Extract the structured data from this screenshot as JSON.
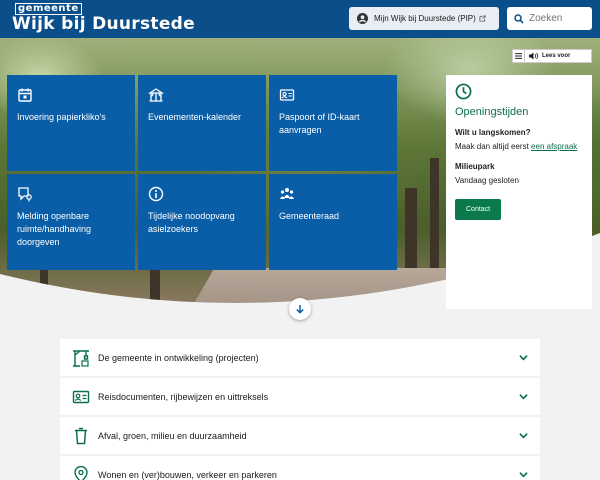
{
  "header": {
    "logo_small": "gemeente",
    "logo_main": "Wijk bij Duurstede",
    "pip_label": "Mijn Wijk bij Duurstede (PIP)",
    "search_placeholder": "Zoeken"
  },
  "readspeaker": {
    "label": "Lees voor"
  },
  "tiles": [
    {
      "label": "Invoering papierkliko's",
      "icon": "calendar-icon"
    },
    {
      "label": "Evenementen-kalender",
      "icon": "tent-icon"
    },
    {
      "label": "Paspoort of ID-kaart aanvragen",
      "icon": "id-card-icon"
    },
    {
      "label": "Melding openbare ruimte/handhaving doorgeven",
      "icon": "report-pin-icon"
    },
    {
      "label": "Tijdelijke noodopvang asielzoekers",
      "icon": "info-icon"
    },
    {
      "label": "Gemeenteraad",
      "icon": "people-icon"
    }
  ],
  "opening_hours": {
    "title": "Openingstijden",
    "question": "Wilt u langskomen?",
    "text_before_link": "Maak dan altijd eerst ",
    "link_text": "een afspraak",
    "location": "Milieupark",
    "status": "Vandaag gesloten",
    "contact_label": "Contact"
  },
  "accordion": [
    {
      "label": "De gemeente in ontwikkeling (projecten)",
      "icon": "crane-icon"
    },
    {
      "label": "Reisdocumenten, rijbewijzen en uittreksels",
      "icon": "id-card-icon"
    },
    {
      "label": "Afval, groen, milieu en duurzaamheid",
      "icon": "bin-icon"
    },
    {
      "label": "Wonen en (ver)bouwen, verkeer en parkeren",
      "icon": "map-pin-icon"
    }
  ],
  "colors": {
    "header": "#0a4e8a",
    "tile": "#0a5ea8",
    "green": "#0a7a4c"
  }
}
